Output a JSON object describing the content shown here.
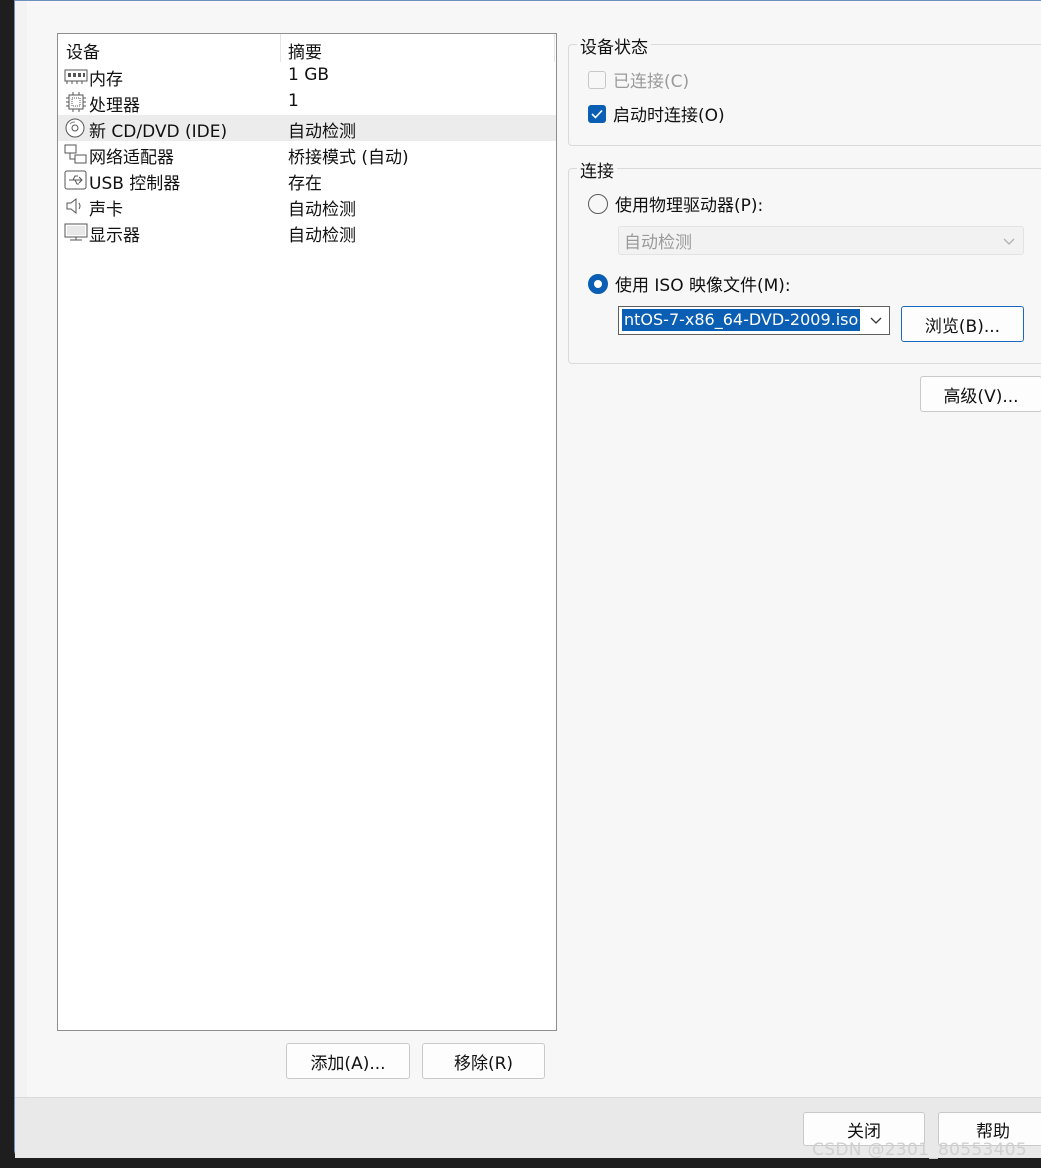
{
  "device_list": {
    "columns": {
      "device": "设备",
      "summary": "摘要"
    },
    "rows": [
      {
        "icon": "memory-icon",
        "name": "内存",
        "summary": "1 GB"
      },
      {
        "icon": "processor-icon",
        "name": "处理器",
        "summary": "1"
      },
      {
        "icon": "cd-dvd-icon",
        "name": "新 CD/DVD (IDE)",
        "summary": "自动检测"
      },
      {
        "icon": "network-adapter-icon",
        "name": "网络适配器",
        "summary": "桥接模式 (自动)"
      },
      {
        "icon": "usb-icon",
        "name": "USB 控制器",
        "summary": "存在"
      },
      {
        "icon": "sound-card-icon",
        "name": "声卡",
        "summary": "自动检测"
      },
      {
        "icon": "display-icon",
        "name": "显示器",
        "summary": "自动检测"
      }
    ],
    "add_label": "添加(A)...",
    "remove_label": "移除(R)"
  },
  "device_status": {
    "title": "设备状态",
    "connected_label": "已连接(C)",
    "connected_checked": false,
    "connect_at_power_on_label": "启动时连接(O)",
    "connect_at_power_on_checked": true
  },
  "connection": {
    "title": "连接",
    "physical_drive_label": "使用物理驱动器(P):",
    "physical_drive_value": "自动检测",
    "iso_label": "使用 ISO 映像文件(M):",
    "iso_value": "ntOS-7-x86_64-DVD-2009.iso",
    "browse_label": "浏览(B)...",
    "selected": "iso"
  },
  "advanced_label": "高级(V)...",
  "footer": {
    "close_label": "关闭",
    "help_label": "帮助"
  },
  "watermark": "CSDN @2301_80553405",
  "colors": {
    "accent": "#0a5fb4",
    "selected_row": "#ececec"
  }
}
